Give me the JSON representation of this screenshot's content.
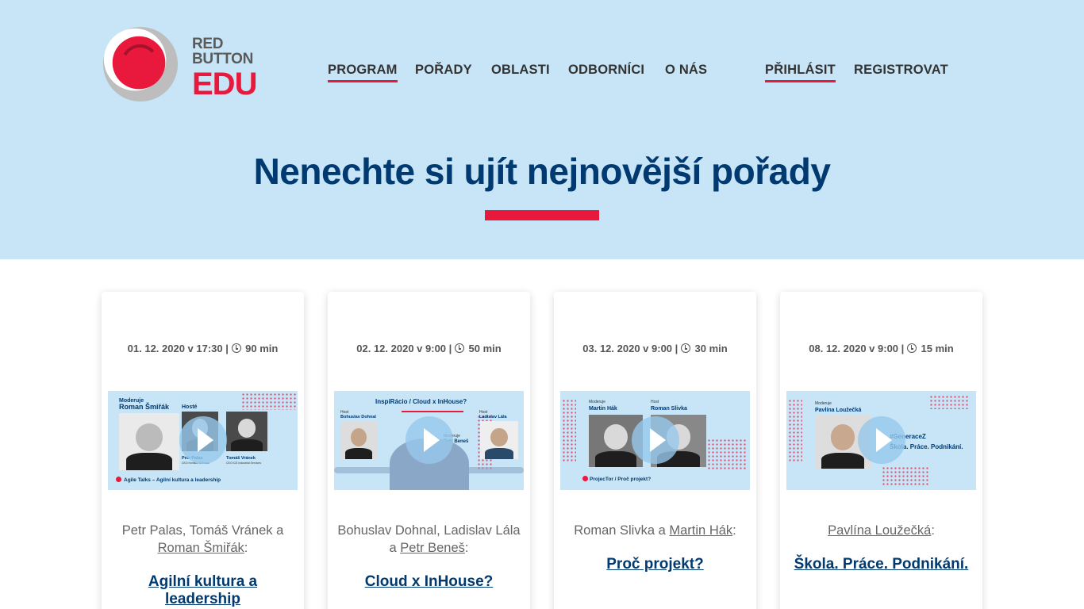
{
  "logo": {
    "line1": "RED",
    "line2": "BUTTON",
    "line3": "EDU"
  },
  "nav": {
    "items": [
      "PROGRAM",
      "POŘADY",
      "OBLASTI",
      "ODBORNÍCI",
      "O NÁS"
    ],
    "login": "PŘIHLÁSIT",
    "register": "REGISTROVAT",
    "active": "PROGRAM"
  },
  "hero": {
    "title": "Nenechte si ujít nejnovější pořady"
  },
  "colors": {
    "hero_bg": "#c7e5f7",
    "accent": "#e8193c",
    "navy": "#003a70"
  },
  "cards": [
    {
      "date": "01. 12. 2020 v 17:30",
      "duration": "90 min",
      "speakers_plain": "Petr Palas, Tomáš Vránek a",
      "speakers_link": "Roman Šmiřák",
      "title": "Agilní kultura a leadership",
      "thumb": {
        "moderator_label": "Moderuje",
        "moderator": "Roman Šmiřák",
        "guests_label": "Hosté",
        "guest1": "Petr Palas",
        "guest1_role": "CEO Kentico Software",
        "guest2": "Tomáš Vránek",
        "guest2_role": "CEO ICE Industrial Services",
        "footer": "Agile Talks – Agilní kultura a leadership"
      }
    },
    {
      "date": "02. 12. 2020 v 9:00",
      "duration": "50 min",
      "speakers_plain": "Bohuslav Dohnal, Ladislav Lála a",
      "speakers_link": "Petr Beneš",
      "title": "Cloud x InHouse?",
      "thumb": {
        "heading": "InspiRácio / Cloud x InHouse?",
        "host1_label": "Host",
        "host1": "Bohuslav Dohnal",
        "moderator_label": "Moderuje",
        "moderator": "Petr Beneš",
        "host2_label": "Host",
        "host2": "Ladislav Lála"
      }
    },
    {
      "date": "03. 12. 2020 v 9:00",
      "duration": "30 min",
      "speakers_plain": "Roman Slivka a",
      "speakers_link": "Martin Hák",
      "title": "Proč projekt?",
      "thumb": {
        "moderator_label": "Moderuje",
        "moderator": "Martin Hák",
        "host_label": "Host",
        "host": "Roman Slivka",
        "footer": "ProjecTor / Proč projekt?"
      }
    },
    {
      "date": "08. 12. 2020 v 9:00",
      "duration": "15 min",
      "speakers_plain": "",
      "speakers_link": "Pavlína Loužečká",
      "title": "Škola. Práce. Podnikání.",
      "thumb": {
        "moderator_label": "Moderuje",
        "moderator": "Pavlína Loužečká",
        "tag": "#GeneraceZ",
        "tagline": "Škola. Práce. Podnikání."
      }
    }
  ]
}
